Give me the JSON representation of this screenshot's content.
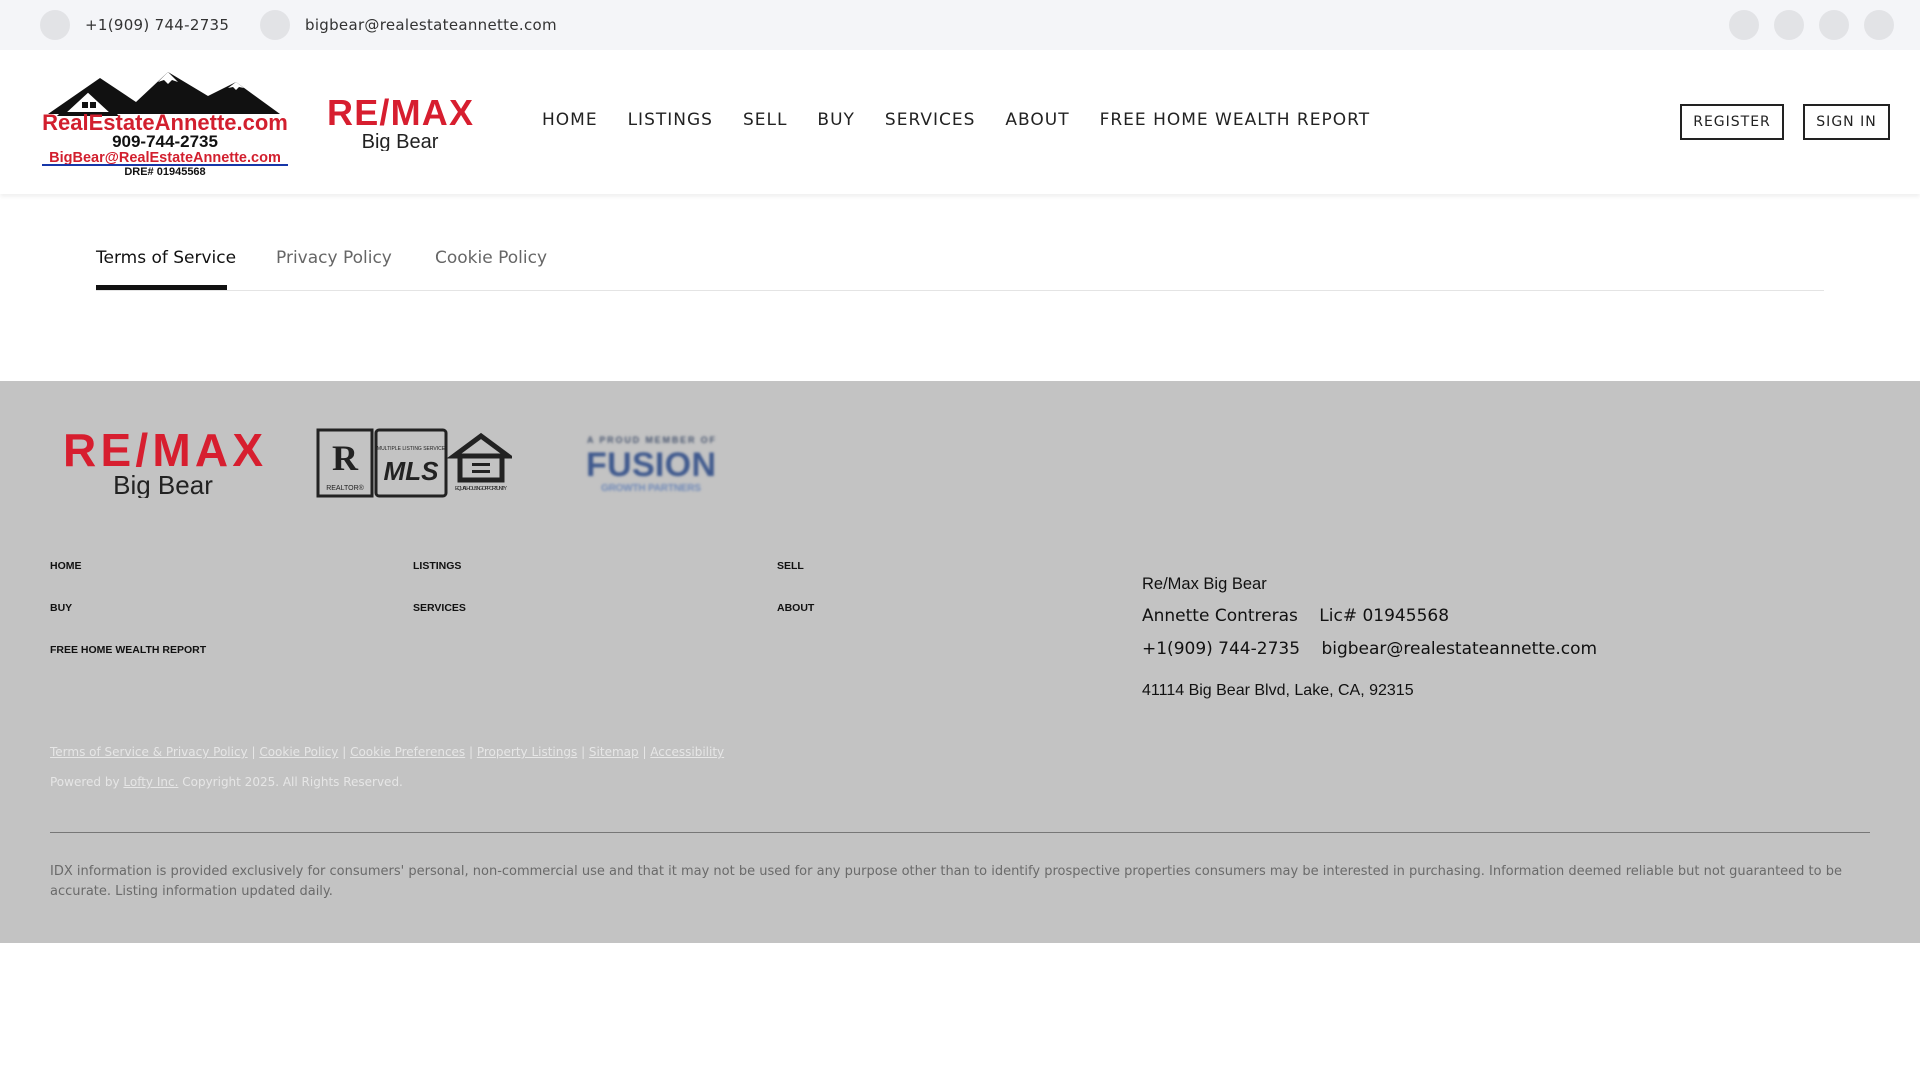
{
  "topbar": {
    "phone": "+1(909) 744-2735",
    "email": "bigbear@realestateannette.com",
    "social_icons": [
      "social-icon-1",
      "social-icon-2",
      "social-icon-3",
      "social-icon-4"
    ]
  },
  "header": {
    "logo_annette": {
      "site": "RealEstateAnnette.com",
      "phone": "909-744-2735",
      "email": "BigBear@RealEstateAnnette.com",
      "dre": "DRE# 01945568"
    },
    "logo_remax": {
      "brand": "RE/MAX",
      "sub": "Big Bear"
    },
    "nav": [
      "HOME",
      "LISTINGS",
      "SELL",
      "BUY",
      "SERVICES",
      "ABOUT",
      "FREE HOME WEALTH REPORT"
    ],
    "register_label": "REGISTER",
    "signin_label": "SIGN IN"
  },
  "tabs": [
    "Terms of Service",
    "Privacy Policy",
    "Cookie Policy"
  ],
  "footer": {
    "logo_remax": {
      "brand": "RE/MAX",
      "sub": "Big Bear"
    },
    "logo_mls": {
      "realtor": "REALTOR®",
      "mls_small": "MULTIPLE LISTING SERVICE",
      "mls": "MLS",
      "eho": "EQUAL HOUSING OPPORTUNITY"
    },
    "logo_fusion": {
      "top": "A PROUD MEMBER OF",
      "brand": "FUSION",
      "sub": "GROWTH PARTNERS"
    },
    "nav": [
      "HOME",
      "LISTINGS",
      "SELL",
      "BUY",
      "SERVICES",
      "ABOUT",
      "FREE HOME WEALTH REPORT"
    ],
    "office": {
      "name": "Re/Max Big Bear",
      "agent": "Annette Contreras",
      "license": "Lic# 01945568",
      "phone": "+1(909) 744-2735",
      "email": "bigbear@realestateannette.com",
      "address": "41114 Big Bear Blvd, Lake, CA, 92315"
    },
    "legal_links": [
      "Terms of Service & Privacy Policy",
      "Cookie Policy",
      "Cookie Preferences",
      "Property Listings",
      "Sitemap",
      "Accessibility"
    ],
    "powered_prefix": "Powered by",
    "powered_link": "Lofty Inc.",
    "copyright": "Copyright 2025. All Rights Reserved.",
    "idx_text": "IDX information is provided exclusively for consumers' personal, non-commercial use and that it may not be used for any purpose other than to identify prospective properties consumers may be interested in purchasing. Information deemed reliable but not guaranteed to be accurate. Listing information updated daily."
  },
  "colors": {
    "remax_red": "#d71e2f",
    "remax_blue": "#1d3f8f",
    "annette_blue": "#1636a8",
    "annette_red": "#d21f2e"
  }
}
